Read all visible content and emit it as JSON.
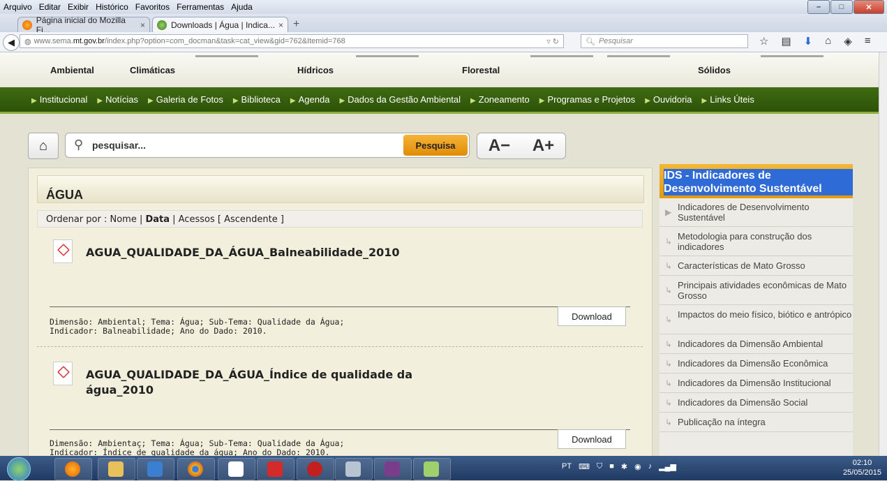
{
  "window": {
    "menu": [
      "Arquivo",
      "Editar",
      "Exibir",
      "Histórico",
      "Favoritos",
      "Ferramentas",
      "Ajuda"
    ]
  },
  "tabs": [
    {
      "label": "Página inicial do Mozilla Fi...",
      "close": "×",
      "icon": "firefox-icon"
    },
    {
      "label": "Downloads | Água | Indica...",
      "close": "×",
      "icon": "sema-icon"
    }
  ],
  "newtab": "+",
  "url": {
    "prefix": "www.sema.",
    "domain": "mt.gov.br",
    "rest": "/index.php?option=com_docman&task=cat_view&gid=762&Itemid=768"
  },
  "search": {
    "placeholder": "Pesquisar"
  },
  "site": {
    "top_categories": [
      "Ambiental",
      "Climáticas",
      "Hídricos",
      "Florestal",
      "Sólidos"
    ],
    "nav": [
      "Institucional",
      "Notícias",
      "Galeria de Fotos",
      "Biblioteca",
      "Agenda",
      "Dados da Gestão Ambiental",
      "Zoneamento",
      "Programas e Projetos",
      "Ouvidoria",
      "Links Úteis"
    ],
    "search_placeholder": "pesquisar...",
    "search_button": "Pesquisa",
    "font_decrease": "A−",
    "font_increase": "A+",
    "main": {
      "title": "ÁGUA",
      "sort": {
        "prefix": "Ordenar por : Nome | ",
        "active": "Data",
        "suffix": " | Acessos [ Ascendente ]"
      },
      "documents": [
        {
          "title": "AGUA_QUALIDADE_DA_ÁGUA_Balneabilidade_2010",
          "meta1": "Dimensão: Ambiental; Tema: Água; Sub-Tema: Qualidade da Água;",
          "meta2": "Indicador: Balneabilidade; Ano do Dado: 2010.",
          "download": "Download"
        },
        {
          "title": "AGUA_QUALIDADE_DA_ÁGUA_Índice de qualidade da água_2010",
          "meta1": "Dimensão: Ambientaç; Tema: Água; Sub-Tema: Qualidade da Água;",
          "meta2": "Indicador: Índice de qualidade da água; Ano do Dado: 2010.",
          "download": "Download"
        }
      ]
    },
    "sidebar": {
      "title": "IDS - Indicadores de Desenvolvimento Sustentável",
      "items": [
        "Indicadores de Desenvolvimento Sustentável",
        "Metodologia para construção dos indicadores",
        "Características de Mato Grosso",
        "Principais atividades econômicas de Mato Grosso",
        "Impactos do meio físico, biótico e antrópico",
        "Indicadores da Dimensão Ambiental",
        "Indicadores da Dimensão Econômica",
        "Indicadores da Dimensão Institucional",
        "Indicadores da Dimensão Social",
        "Publicação na íntegra"
      ]
    }
  },
  "taskbar": {
    "lang": "PT",
    "time": "02:10",
    "date": "25/05/2015"
  }
}
